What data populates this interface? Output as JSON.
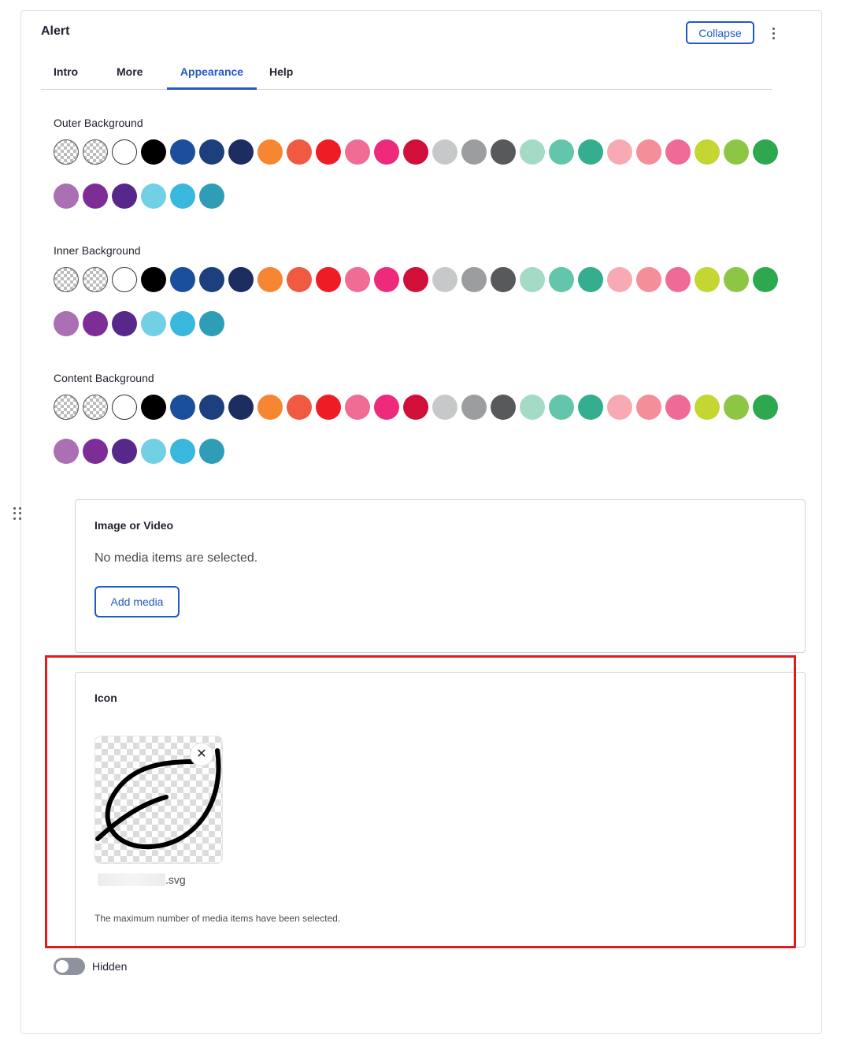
{
  "header": {
    "title": "Alert",
    "collapse_label": "Collapse"
  },
  "tabs": [
    {
      "label": "Intro",
      "active": false
    },
    {
      "label": "More",
      "active": false
    },
    {
      "label": "Appearance",
      "active": true
    },
    {
      "label": "Help",
      "active": false
    }
  ],
  "palette": [
    "transparent",
    "transparent",
    "#ffffff",
    "#000000",
    "#1b4f9c",
    "#1d3f7d",
    "#1e2d61",
    "#f68631",
    "#f05a40",
    "#ee1c25",
    "#f06c95",
    "#ee2b7b",
    "#d0103a",
    "#c7c8c9",
    "#9c9d9f",
    "#58595b",
    "#a5dbc6",
    "#63c5ac",
    "#34ae8e",
    "#f8aab4",
    "#f48e98",
    "#ef6a97",
    "#c3d631",
    "#8dc645",
    "#2ea84f",
    "#ab6fb3",
    "#7d2e96",
    "#57288c",
    "#72d0e5",
    "#3ab7dc",
    "#2f9db5"
  ],
  "color_sections": [
    {
      "label": "Outer Background"
    },
    {
      "label": "Inner Background"
    },
    {
      "label": "Content Background"
    }
  ],
  "media_panel": {
    "title": "Image or Video",
    "empty_text": "No media items are selected.",
    "add_label": "Add media"
  },
  "icon_panel": {
    "title": "Icon",
    "remove_symbol": "✕",
    "file_ext": ".svg",
    "max_message": "The maximum number of media items have been selected."
  },
  "hidden_toggle": {
    "label": "Hidden",
    "on": false
  }
}
